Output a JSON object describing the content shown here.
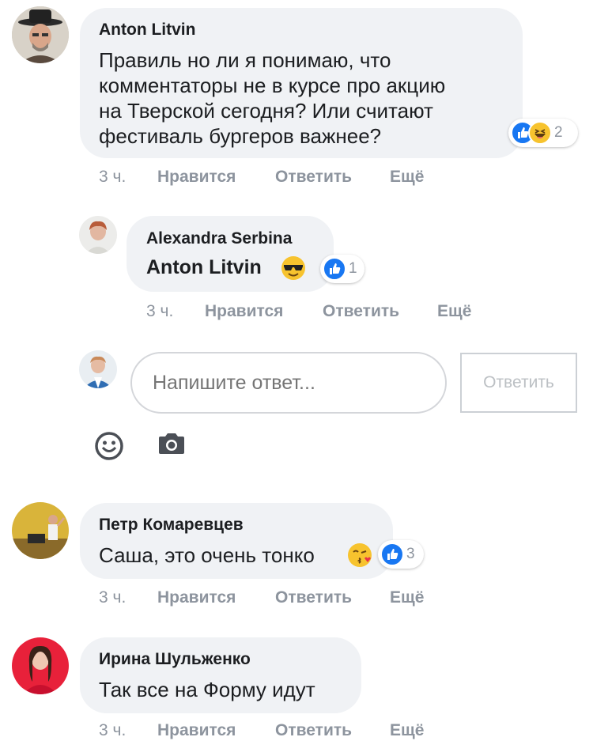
{
  "actions": {
    "like": "Нравится",
    "reply": "Ответить",
    "more": "Ещё"
  },
  "comments": [
    {
      "author": "Anton Litvin",
      "text_lines": [
        "Правиль но ли я понимаю, что",
        "комментаторы не в курсе про акцию",
        "на Тверской сегодня? Или считают",
        "фестиваль бургеров важнее?"
      ],
      "time": "3 ч.",
      "reactions": [
        "like-icon",
        "haha-icon"
      ],
      "reaction_count": "2"
    },
    {
      "author": "Alexandra Serbina",
      "mention": "Anton Litvin",
      "emoji": "sunglasses-emoji",
      "time": "3 ч.",
      "reactions": [
        "like-icon"
      ],
      "reaction_count": "1"
    },
    {
      "author": "Петр Комаревцев",
      "text": "Саша, это очень тонко",
      "emoji": "kiss-emoji",
      "time": "3 ч.",
      "reactions": [
        "like-icon"
      ],
      "reaction_count": "3"
    },
    {
      "author": "Ирина Шульженко",
      "text": "Так все на Форму идут",
      "time": "3 ч."
    }
  ],
  "reply_box": {
    "placeholder": "Напишите ответ...",
    "submit_label": "Ответить",
    "icons": [
      "emoji-icon",
      "camera-icon"
    ]
  },
  "colors": {
    "bubble": "#f0f2f5",
    "like": "#1877f2",
    "muted": "#8d949e"
  }
}
